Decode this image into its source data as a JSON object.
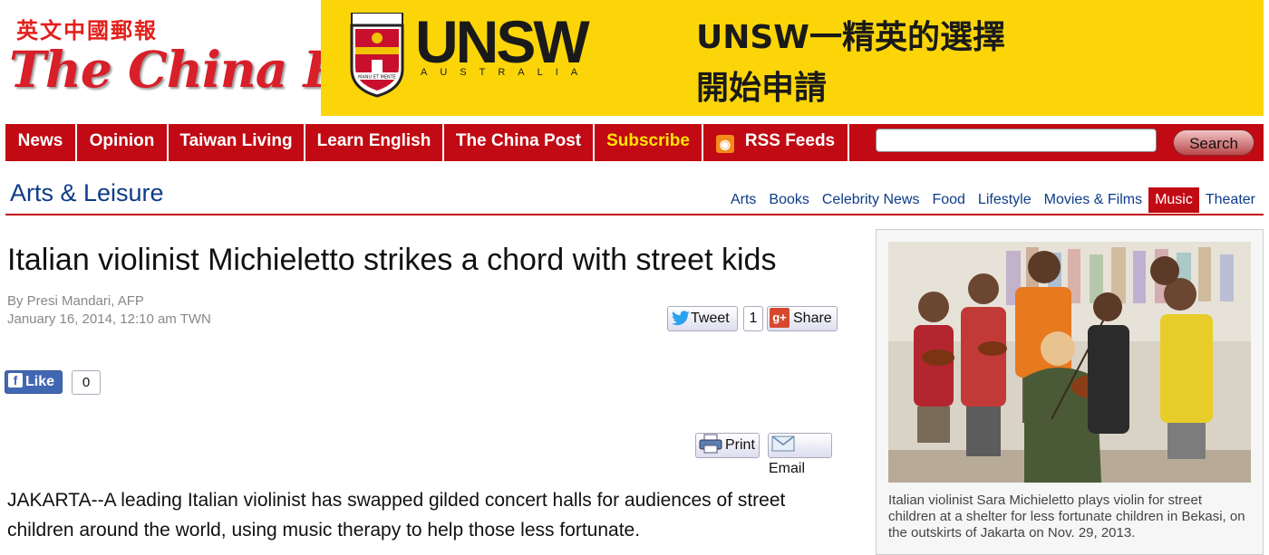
{
  "logo": {
    "chinese": "英文中國郵報",
    "english": "The China Post"
  },
  "banner": {
    "brand": "UNSW",
    "brand_sub": "AUSTRALIA",
    "crest_motto": "MANU ET MENTE",
    "line1": "UNSW一精英的選擇",
    "line2": "開始申請",
    "bg_color": "#fbd508"
  },
  "nav": {
    "items": [
      "News",
      "Opinion",
      "Taiwan Living",
      "Learn English",
      "The China Post",
      "Subscribe",
      "RSS Feeds"
    ],
    "search_placeholder": "",
    "search_label": "Search",
    "bg_color": "#c10a13",
    "subscribe_color": "#ffe600"
  },
  "section": {
    "title": "Arts & Leisure",
    "subnav": [
      "Arts",
      "Books",
      "Celebrity News",
      "Food",
      "Lifestyle",
      "Movies & Films",
      "Music",
      "Theater"
    ],
    "active": "Music"
  },
  "article": {
    "headline": "Italian violinist Michieletto strikes a chord with street kids",
    "byline": "By Presi Mandari, AFP",
    "date": "January 16, 2014, 12:10 am TWN",
    "tweet_label": "Tweet",
    "tweet_count": "1",
    "share_label": "Share",
    "like_label": "Like",
    "like_count": "0",
    "print_label": "Print",
    "email_label": "Email",
    "body": "JAKARTA--A leading Italian violinist has swapped gilded concert halls for audiences of street children around the world, using music therapy to help those less fortunate."
  },
  "photo": {
    "caption": "Italian violinist Sara Michieletto plays violin for street children at a shelter for less fortunate children in Bekasi, on the outskirts of Jakarta on Nov. 29, 2013."
  }
}
